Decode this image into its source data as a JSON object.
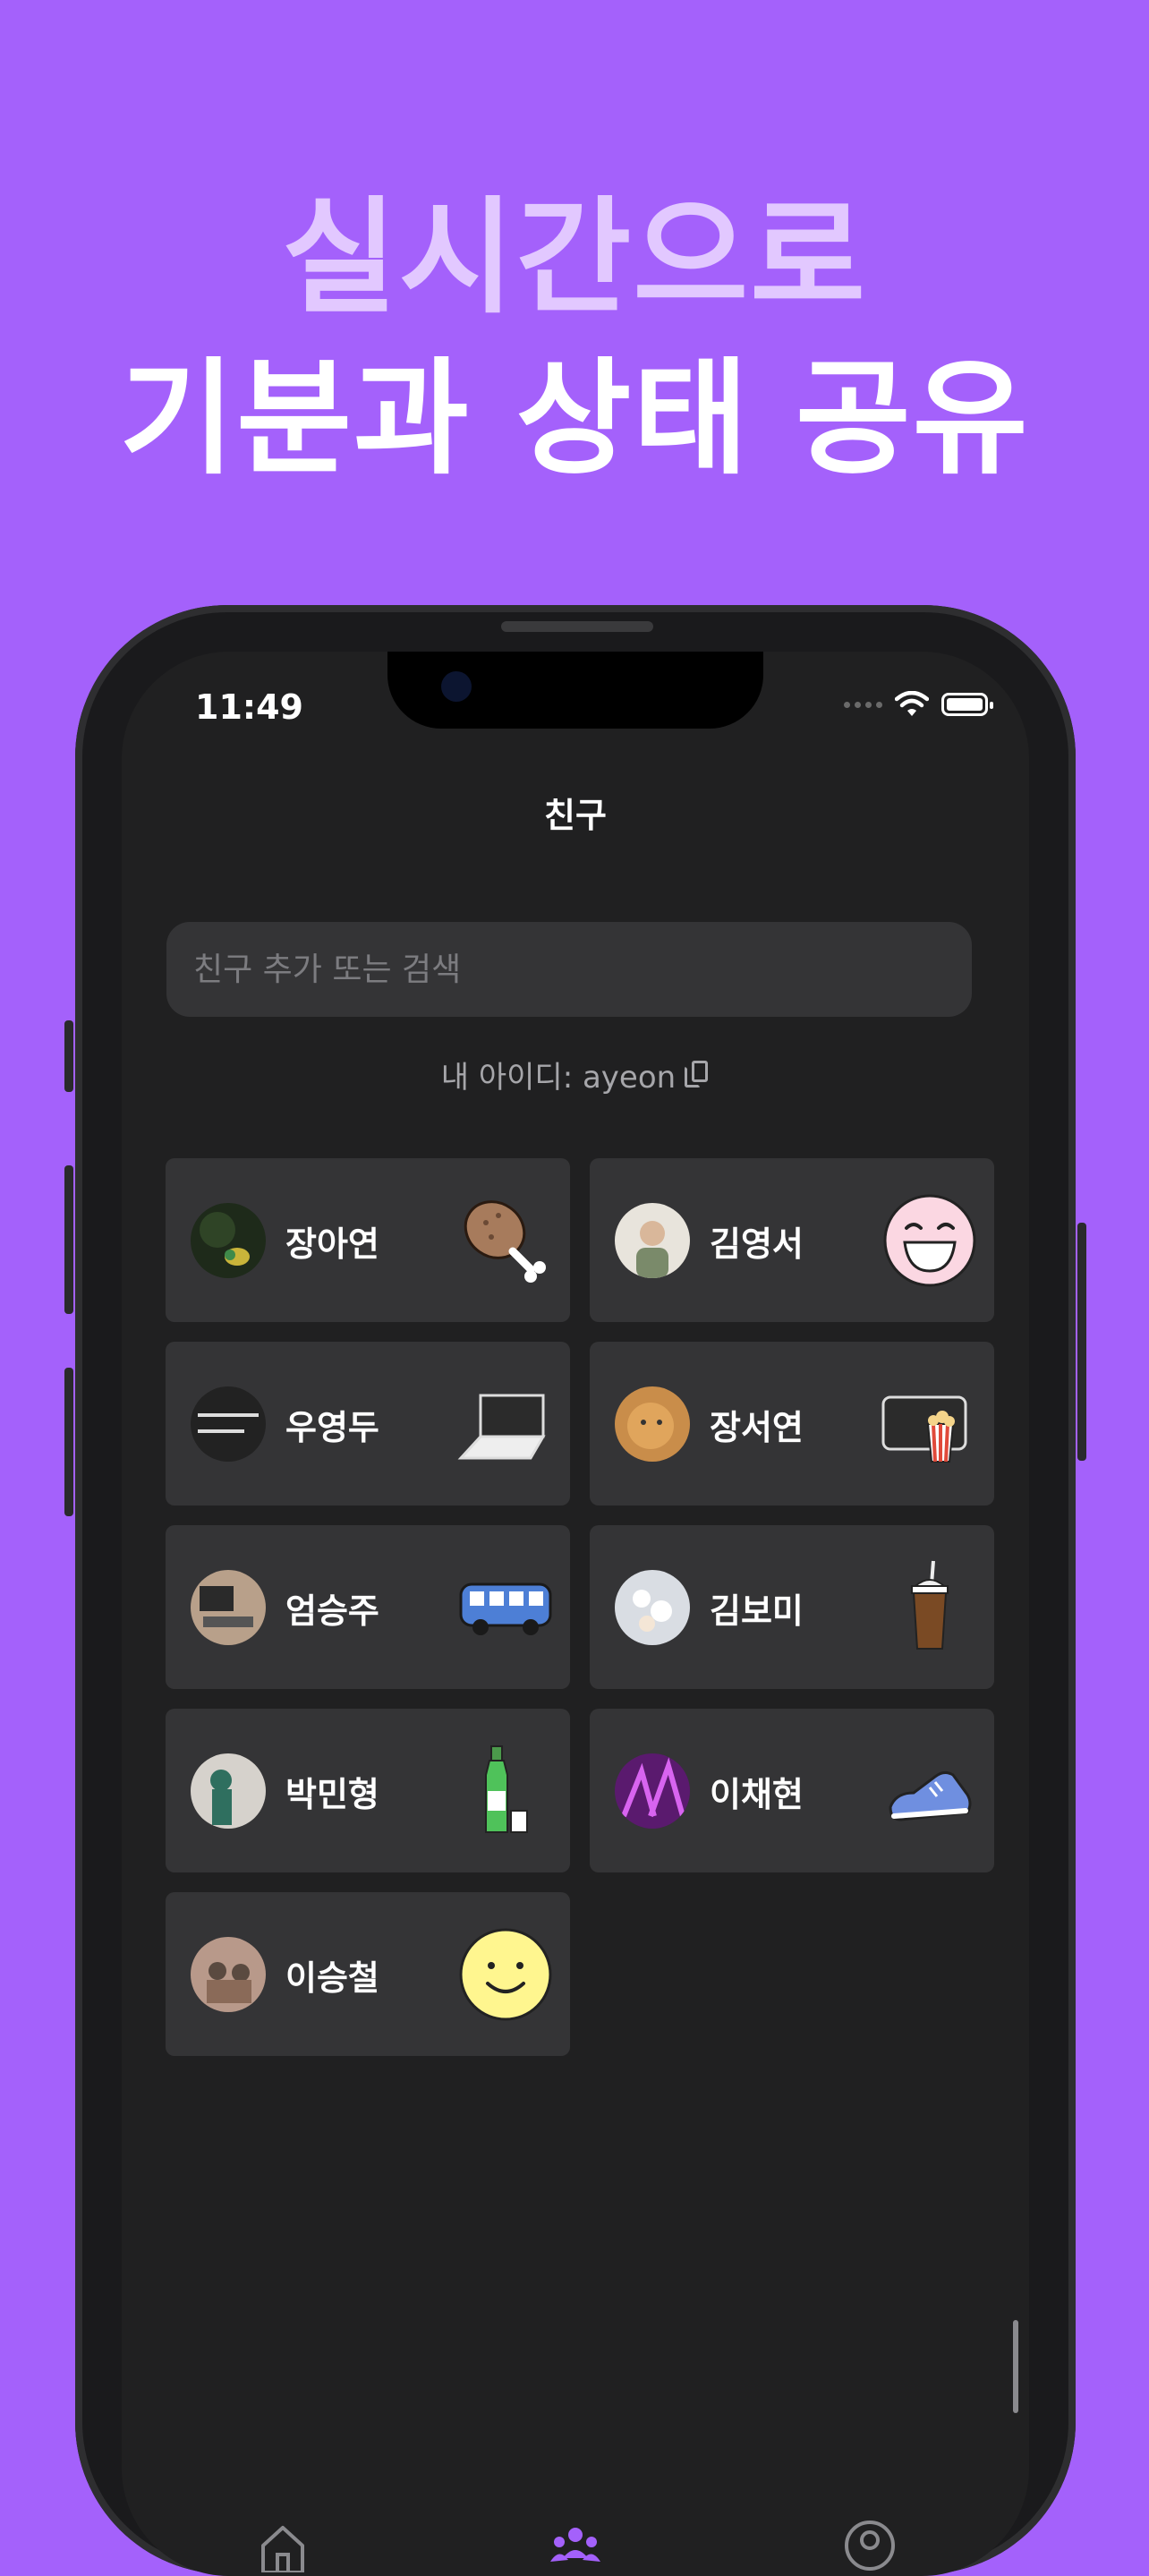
{
  "promo": {
    "line1": "실시간으로",
    "line2": "기분과 상태 공유"
  },
  "status_bar": {
    "time": "11:49"
  },
  "nav": {
    "title": "친구"
  },
  "search": {
    "placeholder": "친구 추가 또는 검색"
  },
  "my_id": {
    "label": "내 아이디: ayeon"
  },
  "friends": [
    {
      "name": "장아연",
      "status_icon": "chicken-leg-icon"
    },
    {
      "name": "김영서",
      "status_icon": "laughing-face-icon"
    },
    {
      "name": "우영두",
      "status_icon": "laptop-icon"
    },
    {
      "name": "장서연",
      "status_icon": "movie-popcorn-icon"
    },
    {
      "name": "엄승주",
      "status_icon": "bus-icon"
    },
    {
      "name": "김보미",
      "status_icon": "iced-coffee-icon"
    },
    {
      "name": "박민형",
      "status_icon": "soju-bottle-icon"
    },
    {
      "name": "이채현",
      "status_icon": "sneaker-icon"
    },
    {
      "name": "이승철",
      "status_icon": "smiley-face-icon"
    }
  ],
  "tabs": [
    {
      "name": "home",
      "icon": "home-icon"
    },
    {
      "name": "friends",
      "icon": "people-icon",
      "active": true
    },
    {
      "name": "profile",
      "icon": "profile-icon"
    }
  ],
  "colors": {
    "background": "#a461fb",
    "screen": "#202021",
    "card": "#343436",
    "accent": "#a461fb"
  }
}
